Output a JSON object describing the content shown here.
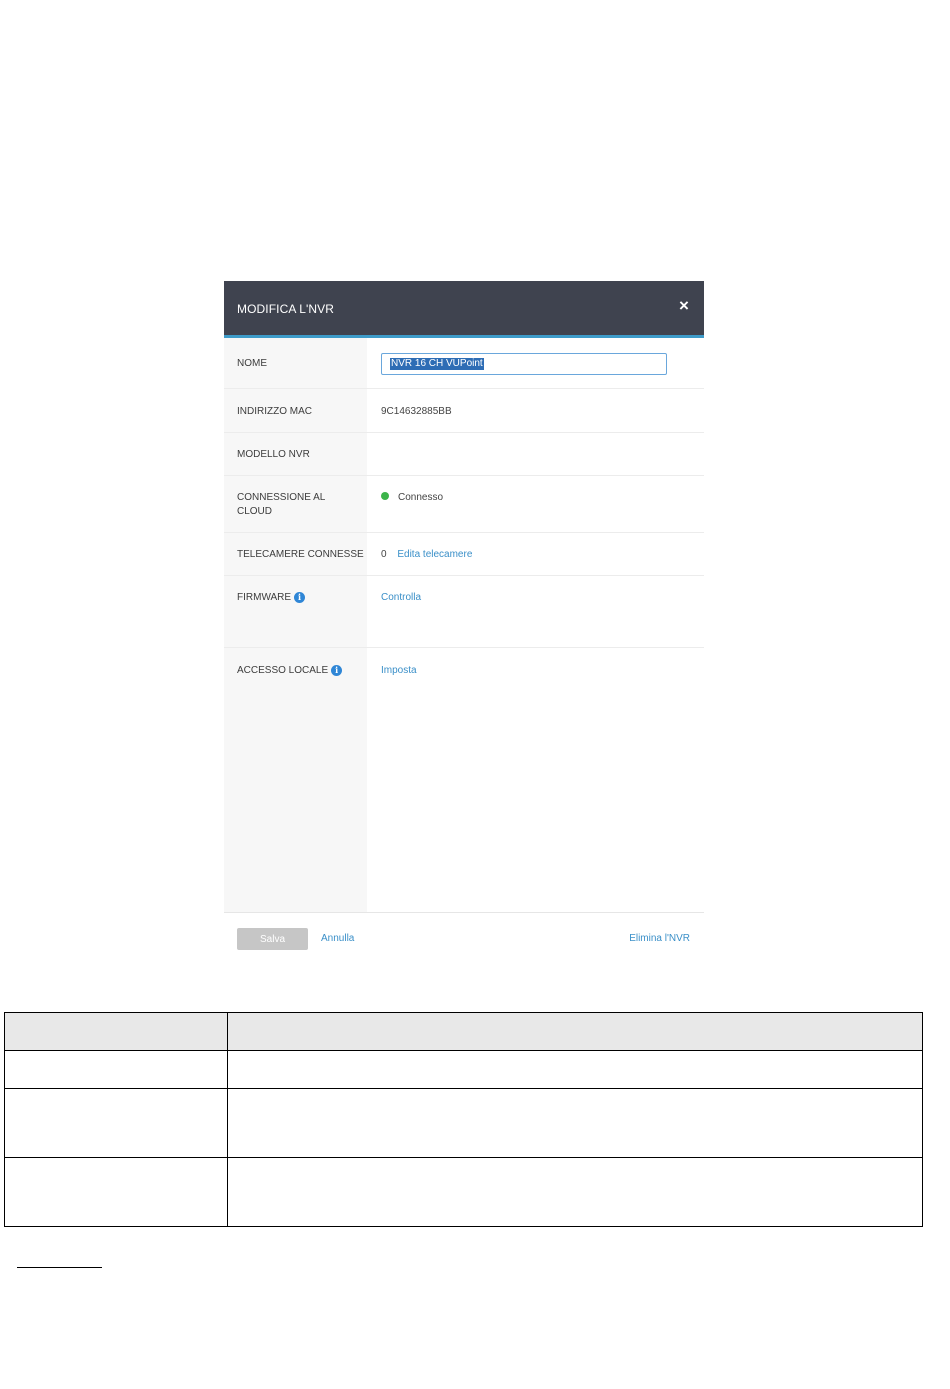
{
  "modal": {
    "title": "MODIFICA L'NVR",
    "close_icon": "×",
    "fields": {
      "name": {
        "label": "NOME",
        "value": "NVR 16 CH VUPoint"
      },
      "mac": {
        "label": "INDIRIZZO MAC",
        "value": "9C14632885BB"
      },
      "model": {
        "label": "MODELLO NVR",
        "value": ""
      },
      "cloud": {
        "label": "CONNESSIONE AL CLOUD",
        "value": "Connesso",
        "status_color": "#3cb44a"
      },
      "cameras": {
        "label": "TELECAMERE CONNESSE",
        "count": "0",
        "link": "Edita telecamere"
      },
      "firmware": {
        "label": "FIRMWARE",
        "link": "Controlla",
        "icon": "info-icon"
      },
      "local_access": {
        "label": "ACCESSO LOCALE",
        "link": "Imposta",
        "icon": "info-icon"
      }
    },
    "footer": {
      "save_label": "Salva",
      "cancel_label": "Annulla",
      "delete_label": "Elimina l'NVR"
    }
  },
  "colors": {
    "header_bg": "#3f434f",
    "header_accent": "#3d9bc9",
    "link": "#3a8fc8",
    "info_icon": "#2f86d6"
  }
}
